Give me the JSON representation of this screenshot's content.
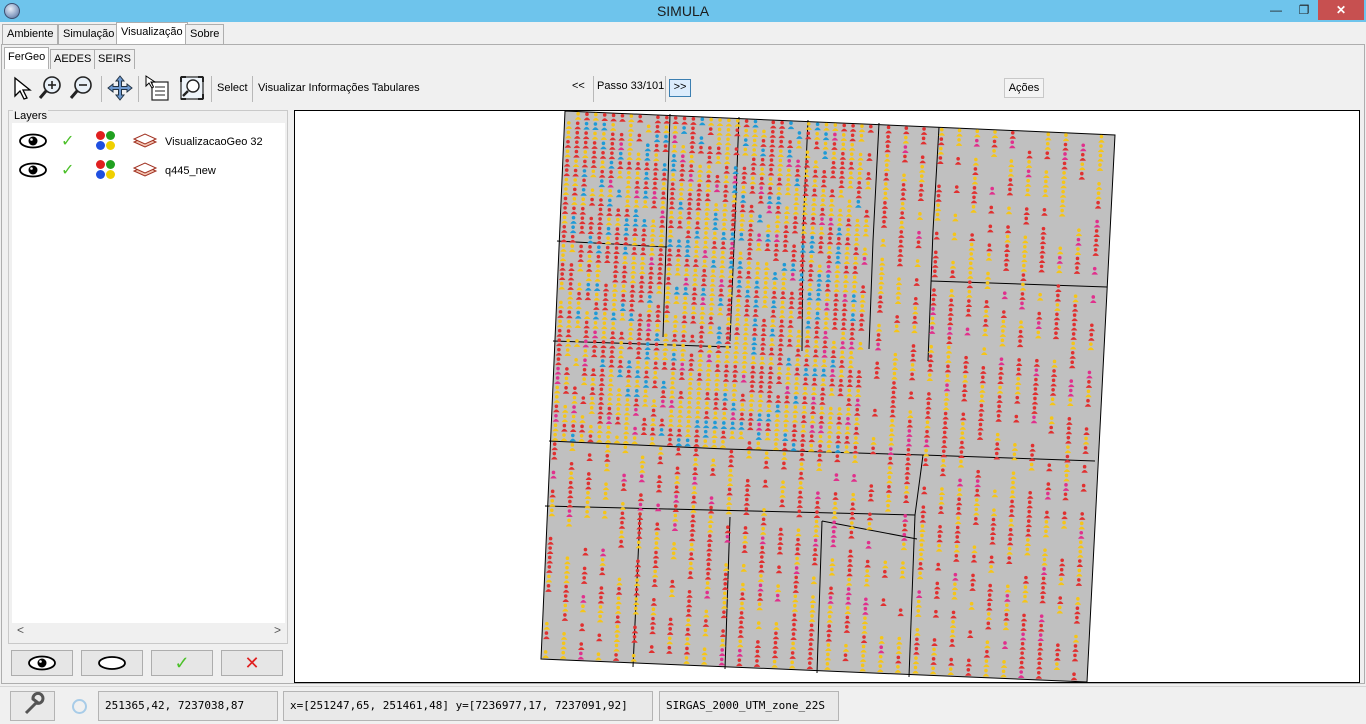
{
  "window": {
    "title": "SIMULA",
    "minimize": "—",
    "maximize": "❐",
    "close": "✕"
  },
  "main_tabs": [
    "Ambiente",
    "Simulação",
    "Visualização",
    "Sobre"
  ],
  "sub_tabs": [
    "FerGeo",
    "AEDES",
    "SEIRS"
  ],
  "toolbar": {
    "icons": [
      "pointer-icon",
      "zoom-in-icon",
      "zoom-out-icon",
      "pan-icon",
      "info-select-icon",
      "zoom-extent-icon"
    ],
    "select_label": "Select",
    "tabular_label": "Visualizar Informações Tabulares",
    "prev_label": "<<",
    "step_label": "Passo 33/101",
    "next_label": ">>",
    "actions_label": "Ações"
  },
  "layers": {
    "title": "Layers",
    "items": [
      {
        "name": "VisualizacaoGeo 32",
        "visible": true,
        "checked": true
      },
      {
        "name": "q445_new",
        "visible": true,
        "checked": true
      }
    ],
    "scroll_left": "<",
    "scroll_right": ">"
  },
  "layer_buttons": [
    {
      "name": "show-all-button",
      "icon": "eye-open-icon"
    },
    {
      "name": "hide-all-button",
      "icon": "eye-closed-icon"
    },
    {
      "name": "check-all-button",
      "icon": "check-icon",
      "glyph": "✓"
    },
    {
      "name": "uncheck-all-button",
      "icon": "x-icon",
      "glyph": "✕"
    }
  ],
  "map": {
    "colors": {
      "background": "#c0c0c0",
      "infected": "#e03030",
      "susceptible": "#f5c518",
      "recovered": "#1e9ad6",
      "exposed": "#e0308c"
    }
  },
  "status": {
    "coords": "251365,42, 7237038,87",
    "extent": "x=[251247,65, 251461,48] y=[7236977,17, 7237091,92]",
    "crs": "SIRGAS_2000_UTM_zone_22S"
  }
}
